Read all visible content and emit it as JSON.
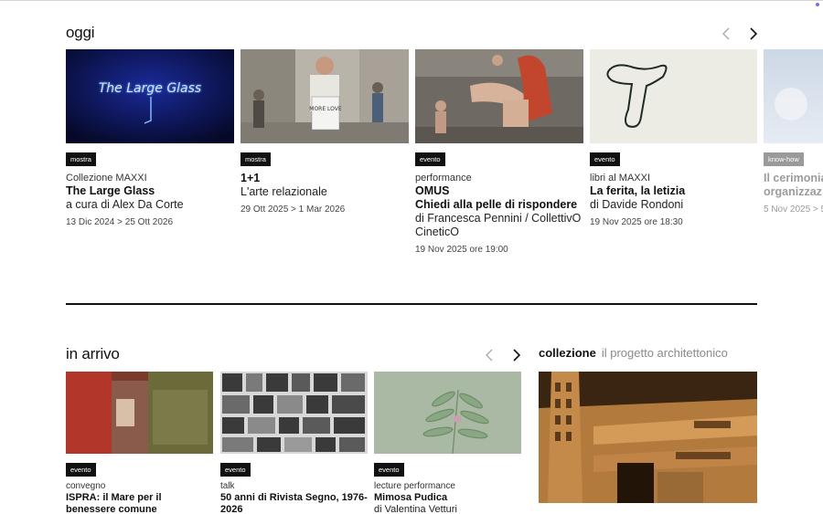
{
  "oggi": {
    "title": "oggi",
    "cards": [
      {
        "tag": "mostra",
        "kicker": "Collezione MAXXI",
        "title": "The Large Glass",
        "sub": "a cura di Alex Da Corte",
        "date": "13 Dic 2024 > 25 Ott 2026",
        "image_text": "The Large Glass"
      },
      {
        "tag": "mostra",
        "kicker": "",
        "title": "1+1",
        "sub": "L'arte relazionale",
        "date": "29 Ott 2025 > 1 Mar 2026",
        "image_text": "MORE LOVE"
      },
      {
        "tag": "evento",
        "kicker": "performance",
        "title": "OMUS",
        "title2": "Chiedi alla pelle di rispondere",
        "sub": "di Francesca Pennini / CollettivO CineticO",
        "date": "19 Nov 2025 ore 19:00"
      },
      {
        "tag": "evento",
        "kicker": "libri al MAXXI",
        "title": "La ferita, la letizia",
        "sub": "di Davide Rondoni",
        "date": "19 Nov 2025 ore 18:30"
      },
      {
        "tag": "know-how",
        "kicker": "",
        "title": "Il cerimonia",
        "title2": "organizzaz",
        "sub": "",
        "date": "5 Nov 2025 > 5"
      }
    ]
  },
  "in_arrivo": {
    "title": "in arrivo",
    "cards": [
      {
        "tag": "evento",
        "kicker": "convegno",
        "title": "ISPRA: il Mare per il benessere comune"
      },
      {
        "tag": "evento",
        "kicker": "talk",
        "title": "50 anni di Rivista Segno, 1976-2026"
      },
      {
        "tag": "evento",
        "kicker": "lecture performance",
        "title": "Mimosa Pudica",
        "sub": "di Valentina Vetturi"
      }
    ]
  },
  "collezione": {
    "label": "collezione",
    "link": "il progetto architettonico"
  },
  "colors": {
    "accent_dot": "#7b6fd6",
    "tag_bg": "#111111",
    "tag_grey": "#9a9a9a"
  }
}
